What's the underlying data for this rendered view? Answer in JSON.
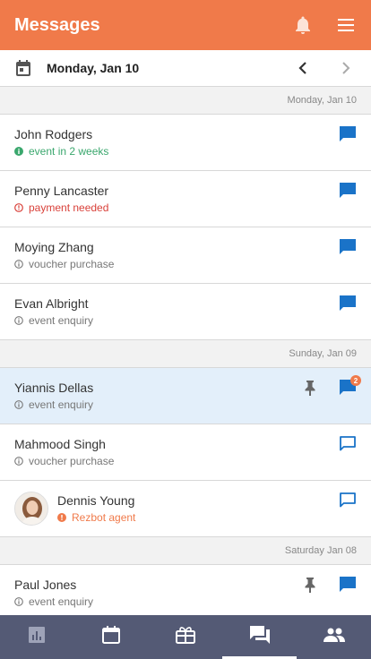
{
  "header": {
    "title": "Messages",
    "icons": [
      "bell-icon",
      "menu-icon"
    ]
  },
  "datebar": {
    "label": "Monday, Jan 10"
  },
  "sections": [
    {
      "date": "Monday, Jan 10",
      "rows": [
        {
          "name": "John Rodgers",
          "status": "event in 2 weeks",
          "status_color": "#3aa76d"
        },
        {
          "name": "Penny Lancaster",
          "status": "payment needed",
          "status_color": "#d9413a"
        },
        {
          "name": "Moying Zhang",
          "status": "voucher purchase",
          "status_color": "#777777"
        },
        {
          "name": "Evan Albright",
          "status": "event enquiry",
          "status_color": "#777777"
        }
      ]
    },
    {
      "date": "Sunday, Jan 09",
      "rows": [
        {
          "name": "Yiannis Dellas",
          "status": "event enquiry",
          "status_color": "#777777",
          "pinned": true,
          "badge": "2"
        },
        {
          "name": "Mahmood Singh",
          "status": "voucher purchase",
          "status_color": "#777777"
        },
        {
          "name": "Dennis Young",
          "status": "Rezbot agent",
          "status_color": "#f07a4a"
        }
      ]
    },
    {
      "date": "Saturday Jan 08",
      "rows": [
        {
          "name": "Paul Jones",
          "status": "event enquiry",
          "status_color": "#777777",
          "pinned": true
        }
      ]
    }
  ],
  "bottom_tabs": [
    "stats-icon",
    "calendar-icon",
    "gift-icon",
    "messages-icon",
    "people-icon"
  ],
  "colors": {
    "accent": "#f07a4a",
    "nav_bg": "#545a75",
    "message_blue": "#1a73c8",
    "selected_bg": "#e3effa"
  }
}
